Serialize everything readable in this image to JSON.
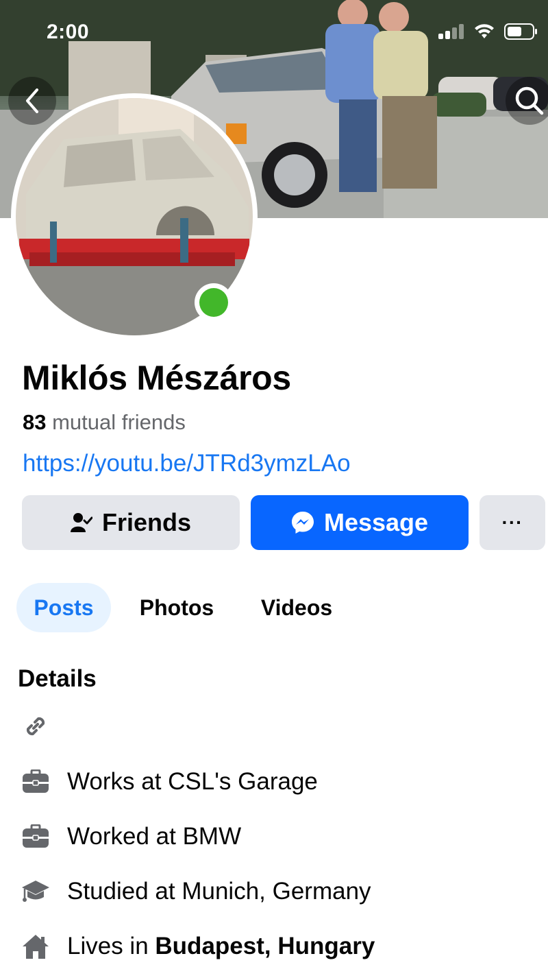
{
  "status_bar": {
    "time": "2:00"
  },
  "profile": {
    "name": "Miklós Mészáros",
    "mutual_count": "83",
    "mutual_label": "mutual friends",
    "link": "https://youtu.be/JTRd3ymzLAo",
    "online": true
  },
  "actions": {
    "friends_label": "Friends",
    "message_label": "Message",
    "more_label": "···"
  },
  "tabs": [
    {
      "label": "Posts",
      "active": true
    },
    {
      "label": "Photos",
      "active": false
    },
    {
      "label": "Videos",
      "active": false
    }
  ],
  "details": {
    "heading": "Details",
    "items": [
      {
        "icon": "link-icon",
        "text": ""
      },
      {
        "icon": "briefcase-icon",
        "text": "Works at CSL's Garage"
      },
      {
        "icon": "briefcase-icon",
        "text": "Worked at BMW"
      },
      {
        "icon": "graduation-cap-icon",
        "text": "Studied at Munich, Germany"
      },
      {
        "icon": "home-icon",
        "prefix": "Lives in ",
        "emphasis": "Budapest, Hungary"
      }
    ]
  },
  "colors": {
    "accent": "#1877f2",
    "message_button": "#0866ff",
    "secondary_button": "#e4e6eb",
    "online": "#42b72a",
    "muted_text": "#65676b"
  }
}
